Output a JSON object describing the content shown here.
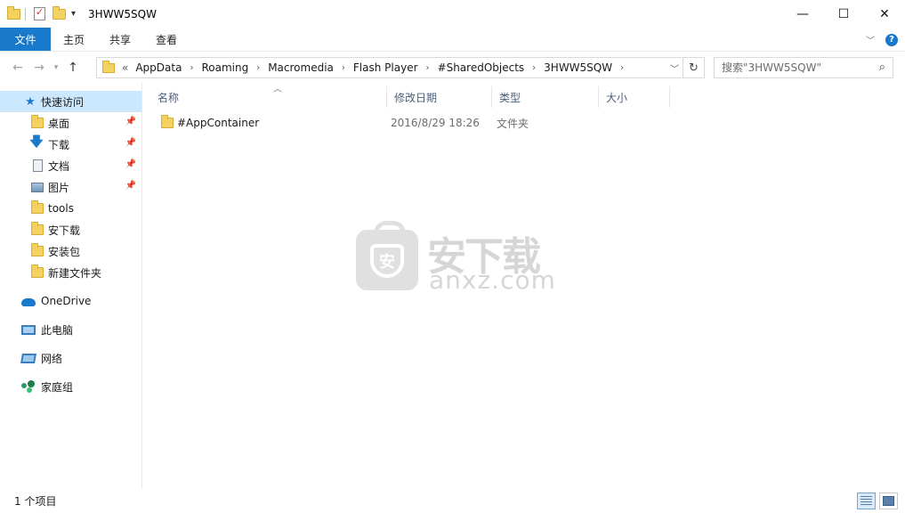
{
  "window": {
    "title": "3HWW5SQW",
    "minimize": "—",
    "maximize": "☐",
    "close": "✕"
  },
  "ribbon": {
    "tabs": [
      "文件",
      "主页",
      "共享",
      "查看"
    ]
  },
  "address": {
    "prefix": "«",
    "crumbs": [
      "AppData",
      "Roaming",
      "Macromedia",
      "Flash Player",
      "#SharedObjects",
      "3HWW5SQW"
    ]
  },
  "search": {
    "placeholder": "搜索\"3HWW5SQW\""
  },
  "sidebar": {
    "quick_access": "快速访问",
    "items": [
      {
        "label": "桌面",
        "icon": "folder-icon",
        "pinned": true
      },
      {
        "label": "下载",
        "icon": "download-icon",
        "pinned": true
      },
      {
        "label": "文档",
        "icon": "document-icon",
        "pinned": true
      },
      {
        "label": "图片",
        "icon": "picture-icon",
        "pinned": true
      },
      {
        "label": "tools",
        "icon": "folder-icon",
        "pinned": false
      },
      {
        "label": "安下载",
        "icon": "folder-icon",
        "pinned": false
      },
      {
        "label": "安装包",
        "icon": "folder-icon",
        "pinned": false
      },
      {
        "label": "新建文件夹",
        "icon": "folder-icon",
        "pinned": false
      }
    ],
    "onedrive": "OneDrive",
    "this_pc": "此电脑",
    "network": "网络",
    "homegroup": "家庭组"
  },
  "columns": {
    "name": "名称",
    "modified": "修改日期",
    "type": "类型",
    "size": "大小"
  },
  "files": [
    {
      "name": "#AppContainer",
      "modified": "2016/8/29 18:26",
      "type": "文件夹",
      "size": ""
    }
  ],
  "watermark": {
    "cn": "安下载",
    "en": "anxz.com",
    "shield": "安"
  },
  "status": {
    "count": "1 个项目"
  },
  "colors": {
    "accent": "#1979ca",
    "selection": "#cce8ff",
    "folder": "#f4d262"
  }
}
